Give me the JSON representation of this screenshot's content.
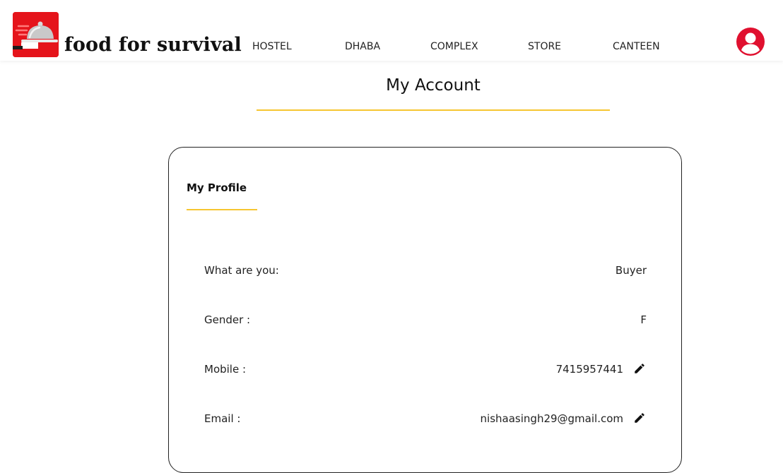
{
  "brand": {
    "name": "food for survival",
    "logo_icon": "cloche-platter-icon",
    "logo_color": "#e5141b"
  },
  "nav": {
    "items": [
      {
        "label": "HOSTEL"
      },
      {
        "label": "DHABA"
      },
      {
        "label": "COMPLEX"
      },
      {
        "label": "STORE"
      },
      {
        "label": "CANTEEN"
      }
    ],
    "user_icon": "user-circle-icon",
    "user_icon_color": "#e0102f"
  },
  "page": {
    "title": "My Account",
    "accent_color": "#f6c631"
  },
  "profile": {
    "title": "My Profile",
    "fields": [
      {
        "label": "What are you:",
        "value": "Buyer",
        "editable": false
      },
      {
        "label": "Gender :",
        "value": "F",
        "editable": false
      },
      {
        "label": "Mobile :",
        "value": "7415957441",
        "editable": true,
        "edit_icon": "pencil-icon"
      },
      {
        "label": "Email :",
        "value": "nishaasingh29@gmail.com",
        "editable": true,
        "edit_icon": "pencil-icon"
      }
    ]
  }
}
